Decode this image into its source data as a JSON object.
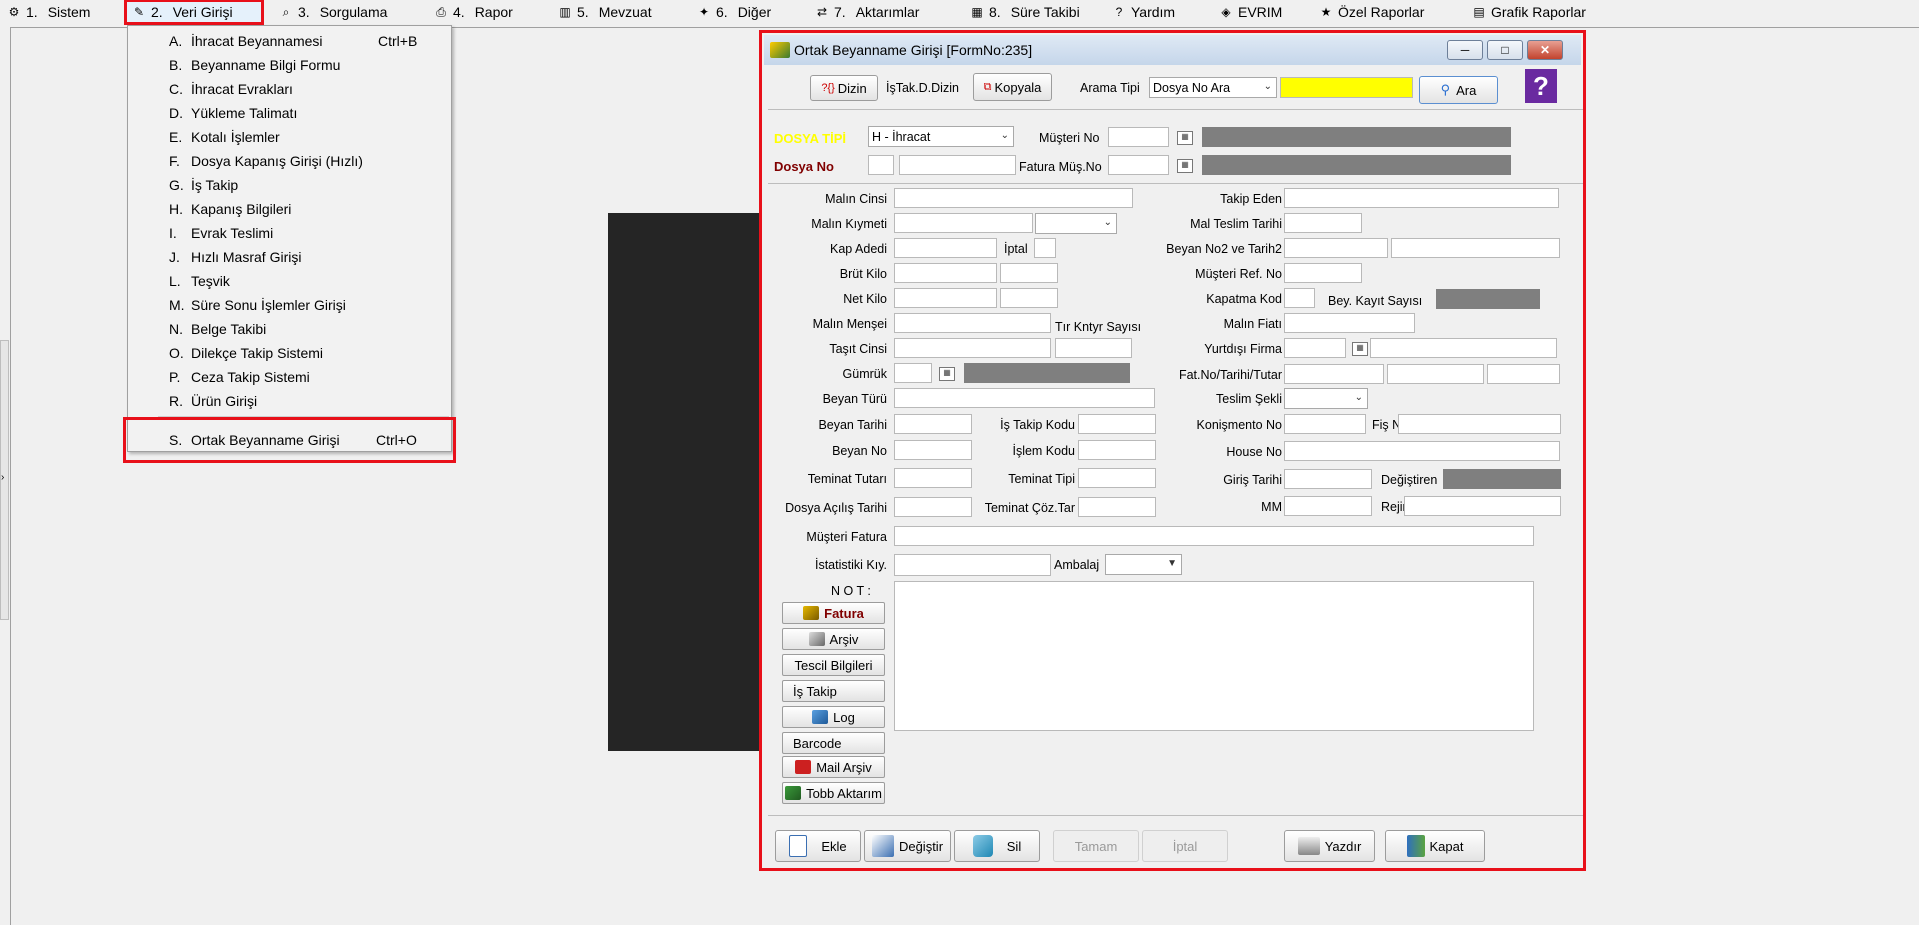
{
  "menubar": [
    {
      "icon": "system-icon",
      "num": "1.",
      "label": "Sistem"
    },
    {
      "icon": "data-entry-icon",
      "num": "2.",
      "label": "Veri Girişi"
    },
    {
      "icon": "query-icon",
      "num": "3.",
      "label": "Sorgulama"
    },
    {
      "icon": "printer-icon",
      "num": "4.",
      "label": "Rapor"
    },
    {
      "icon": "books-icon",
      "num": "5.",
      "label": "Mevzuat"
    },
    {
      "icon": "other-icon",
      "num": "6.",
      "label": "Diğer"
    },
    {
      "icon": "transfer-icon",
      "num": "7.",
      "label": "Aktarımlar"
    },
    {
      "icon": "calendar-icon",
      "num": "8.",
      "label": "Süre Takibi"
    },
    {
      "icon": "help-icon",
      "num": "",
      "label": "Yardım"
    },
    {
      "icon": "evrim-icon",
      "num": "",
      "label": "EVRIM"
    },
    {
      "icon": "star-icon",
      "num": "",
      "label": "Özel Raporlar"
    },
    {
      "icon": "graph-icon",
      "num": "",
      "label": "Grafik Raporlar"
    }
  ],
  "dropdown": {
    "items": [
      {
        "key": "A.",
        "label": "İhracat Beyannamesi",
        "shortcut": "Ctrl+B"
      },
      {
        "key": "B.",
        "label": "Beyanname Bilgi Formu",
        "shortcut": ""
      },
      {
        "key": "C.",
        "label": "İhracat Evrakları",
        "shortcut": ""
      },
      {
        "key": "D.",
        "label": "Yükleme Talimatı",
        "shortcut": ""
      },
      {
        "key": "E.",
        "label": "Kotalı İşlemler",
        "shortcut": ""
      },
      {
        "key": "F.",
        "label": "Dosya Kapanış Girişi (Hızlı)",
        "shortcut": ""
      },
      {
        "key": "G.",
        "label": "İş Takip",
        "shortcut": ""
      },
      {
        "key": "H.",
        "label": "Kapanış Bilgileri",
        "shortcut": ""
      },
      {
        "key": "I.",
        "label": "Evrak Teslimi",
        "shortcut": ""
      },
      {
        "key": "J.",
        "label": "Hızlı Masraf Girişi",
        "shortcut": ""
      },
      {
        "key": "L.",
        "label": "Teşvik",
        "shortcut": ""
      },
      {
        "key": "M.",
        "label": "Süre Sonu İşlemler Girişi",
        "shortcut": ""
      },
      {
        "key": "N.",
        "label": "Belge Takibi",
        "shortcut": ""
      },
      {
        "key": "O.",
        "label": "Dilekçe Takip Sistemi",
        "shortcut": ""
      },
      {
        "key": "P.",
        "label": "Ceza Takip Sistemi",
        "shortcut": ""
      },
      {
        "key": "R.",
        "label": "Ürün Girişi",
        "shortcut": ""
      }
    ],
    "selected": {
      "key": "S.",
      "label": "Ortak Beyanname Girişi",
      "shortcut": "Ctrl+O"
    }
  },
  "dialog": {
    "title": "Ortak Beyanname Girişi [FormNo:235]",
    "toolbar": {
      "dizin": "Dizin",
      "istak": "İşTak.D.Dizin",
      "kopyala": "Kopyala",
      "arama_tipi_label": "Arama Tipi",
      "arama_tipi_value": "Dosya No Ara",
      "search_value": "",
      "ara": "Ara",
      "help_glyph": "?"
    },
    "header": {
      "dosya_tipi_label": "DOSYA TİPİ",
      "dosya_tipi_value": "H - İhracat",
      "dosya_no_label": "Dosya No",
      "musteri_no_label": "Müşteri No",
      "fatura_mus_no_label": "Fatura Müş.No"
    },
    "labels": {
      "malin_cinsi": "Malın Cinsi",
      "malin_kiymeti": "Malın Kıymeti",
      "kap_adedi": "Kap Adedi",
      "iptal": "İptal",
      "brut_kilo": "Brüt Kilo",
      "net_kilo": "Net Kilo",
      "malin_mensei": "Malın Menşei",
      "tir_kntyr": "Tır Kntyr Sayısı",
      "tasit_cinsi": "Taşıt Cinsi",
      "gumruk": "Gümrük",
      "beyan_turu": "Beyan Türü",
      "beyan_tarihi": "Beyan Tarihi",
      "is_takip_kodu": "İş Takip Kodu",
      "beyan_no": "Beyan No",
      "islem_kodu": "İşlem Kodu",
      "teminat_tutari": "Teminat Tutarı",
      "teminat_tipi": "Teminat Tipi",
      "dosya_acilis_tarihi": "Dosya Açılış Tarihi",
      "teminat_coz_tar": "Teminat Çöz.Tar",
      "musteri_fatura": "Müşteri Fatura",
      "istatistiki_kiy": "İstatistiki Kıy.",
      "ambalaj": "Ambalaj",
      "takip_eden": "Takip Eden",
      "mal_teslim_tarihi": "Mal Teslim Tarihi",
      "beyan_no2": "Beyan  No2 ve Tarih2",
      "musteri_ref_no": "Müşteri  Ref. No",
      "kapatma_kod": "Kapatma Kod",
      "bey_kayit_sayisi": "Bey. Kayıt Sayısı",
      "malin_fiati": "Malın Fiatı",
      "yurtdisi_firma": "Yurtdışı Firma",
      "fat_no": "Fat.No/Tarihi/Tutar",
      "teslim_sekli": "Teslim Şekli",
      "konismento_no": "Konişmento No",
      "fis_no": "Fiş No",
      "house_no": "House No",
      "giris_tarihi": "Giriş Tarihi",
      "degistiren": "Değiştiren",
      "mm": "MM",
      "rejim": "Rejim",
      "not": "N O T :"
    },
    "side_buttons": {
      "fatura": "Fatura",
      "arsiv": "Arşiv",
      "tescil": "Tescil Bilgileri",
      "is_takip": "İş Takip",
      "log": "Log",
      "barcode": "Barcode",
      "mail_arsiv": "Mail Arşiv",
      "tobb": "Tobb Aktarım"
    },
    "bottom_buttons": {
      "ekle": "Ekle",
      "degistir": "Değiştir",
      "sil": "Sil",
      "tamam": "Tamam",
      "iptal": "İptal",
      "yazdir": "Yazdır",
      "kapat": "Kapat"
    }
  },
  "colors": {
    "highlight_border": "#e8101a",
    "dosya_tipi_label": "#ffff00",
    "dosya_no_label": "#800000",
    "search_field": "#ffff00",
    "readonly_field": "#7f7f7f"
  }
}
